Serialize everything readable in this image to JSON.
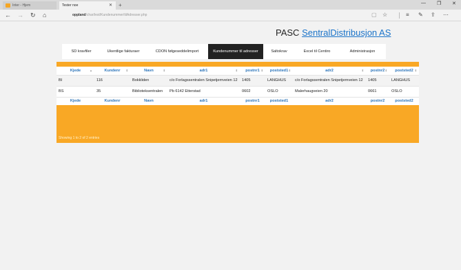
{
  "browser": {
    "tabs": [
      {
        "label": "Inter - Hjem"
      },
      {
        "label": "Tester noe"
      }
    ],
    "url_domain": "oppland",
    "url_path": "/charl/est/Kundenummer/tilAdresser.php"
  },
  "brand": {
    "prefix": "PASC",
    "link": "SentralDistribusjon AS"
  },
  "menu": [
    {
      "label": "SD kravfiler",
      "width": 56
    },
    {
      "label": "Ukentlige fakturaer",
      "width": 66
    },
    {
      "label": "CDON følgeseddelimport",
      "width": 90
    },
    {
      "label": "Kundenummer til adresser",
      "width": 80
    },
    {
      "label": "Saltokrav",
      "width": 46
    },
    {
      "label": "Excel til Centiro",
      "width": 64
    },
    {
      "label": "Administrasjon",
      "width": 68
    }
  ],
  "table": {
    "columns": [
      "Kjede",
      "Kundenr",
      "Navn",
      "adr1",
      "postnr1",
      "poststed1",
      "adr2",
      "postnr2",
      "poststed2"
    ],
    "rows": [
      [
        "BI",
        "116",
        "Bokkliden",
        "c/o Forlagssentralen Snipetjernveien 12",
        "1405",
        "LANGHUS",
        "c/o Forlagssentralen Snipetjernveien 12",
        "1405",
        "LANGHUS"
      ],
      [
        "BS",
        "35",
        "Biblioteksentralen",
        "Pb 6142 Etterstad",
        "0602",
        "OSLO",
        "Malerhaugveien 20",
        "0661",
        "OSLO"
      ]
    ],
    "footer_text": "Showing 1 to 2 of 2 entries"
  },
  "colors": {
    "accent": "#f9a825",
    "link": "#1a73c9",
    "active_menu": "#222222"
  }
}
